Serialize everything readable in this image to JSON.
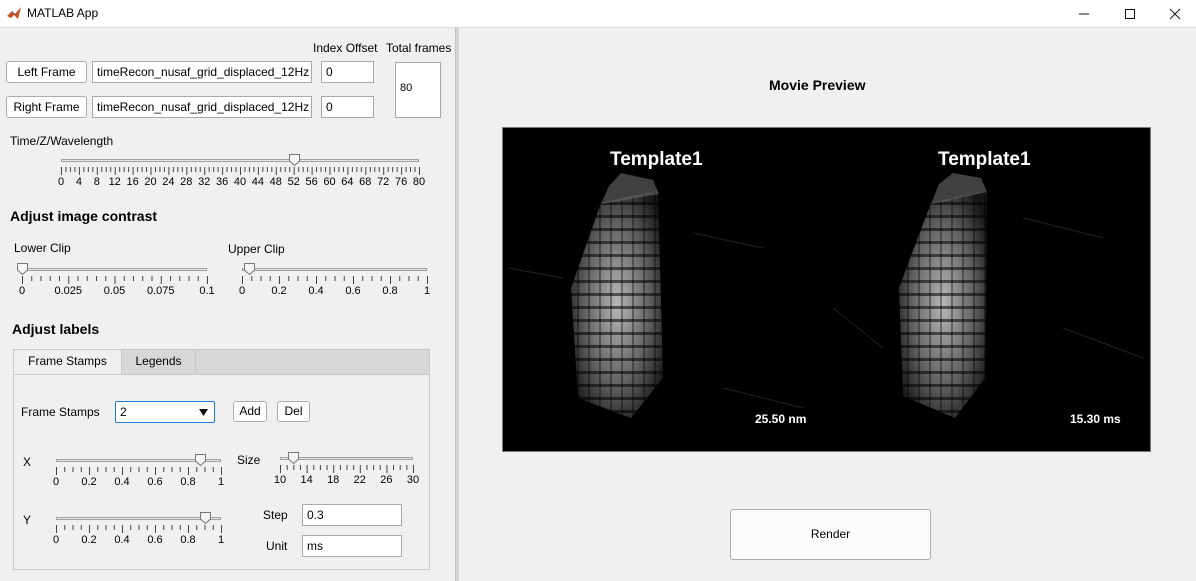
{
  "window": {
    "title": "MATLAB App",
    "minimize_glyph": "—",
    "maximize_glyph": "☐",
    "close_glyph": "✕",
    "icon": "matlab-icon"
  },
  "frames": {
    "index_offset_label": "Index Offset",
    "total_frames_label": "Total frames",
    "left_button": "Left Frame",
    "right_button": "Right Frame",
    "left_file": "timeRecon_nusaf_grid_displaced_12Hz",
    "right_file": "timeRecon_nusaf_grid_displaced_12Hz",
    "left_offset": "0",
    "right_offset": "0",
    "total_frames": "80"
  },
  "time_slider": {
    "label": "Time/Z/Wavelength",
    "value": 52,
    "min": 0,
    "max": 80,
    "tick_labels": [
      "0",
      "4",
      "8",
      "12",
      "16",
      "20",
      "24",
      "28",
      "32",
      "36",
      "40",
      "44",
      "48",
      "52",
      "56",
      "60",
      "64",
      "68",
      "72",
      "76",
      "80"
    ]
  },
  "contrast": {
    "heading": "Adjust image contrast",
    "lower_label": "Lower Clip",
    "upper_label": "Upper Clip",
    "lower_value": 0,
    "upper_value": 0.04,
    "lower_ticks": [
      "0",
      "0.025",
      "0.05",
      "0.075",
      "0.1"
    ],
    "upper_ticks": [
      "0",
      "0.2",
      "0.4",
      "0.6",
      "0.8",
      "1"
    ]
  },
  "labels": {
    "heading": "Adjust labels",
    "tabs": [
      "Frame Stamps",
      "Legends"
    ],
    "frame_stamps_label": "Frame Stamps",
    "frame_stamps_value": "2",
    "add_button": "Add",
    "del_button": "Del",
    "x_label": "X",
    "x_value": 0.87,
    "x_ticks": [
      "0",
      "0.2",
      "0.4",
      "0.6",
      "0.8",
      "1"
    ],
    "size_label": "Size",
    "size_value": 12,
    "size_ticks": [
      "10",
      "14",
      "18",
      "22",
      "26",
      "30"
    ],
    "y_label": "Y",
    "y_value": 0.9,
    "y_ticks": [
      "0",
      "0.2",
      "0.4",
      "0.6",
      "0.8",
      "1"
    ],
    "step_label": "Step",
    "step_value": "0.3",
    "unit_label": "Unit",
    "unit_value": "ms"
  },
  "preview": {
    "title": "Movie Preview",
    "left_title": "Template1",
    "right_title": "Template1",
    "left_stamp": "25.50 nm",
    "right_stamp": "15.30 ms",
    "render_button": "Render"
  }
}
